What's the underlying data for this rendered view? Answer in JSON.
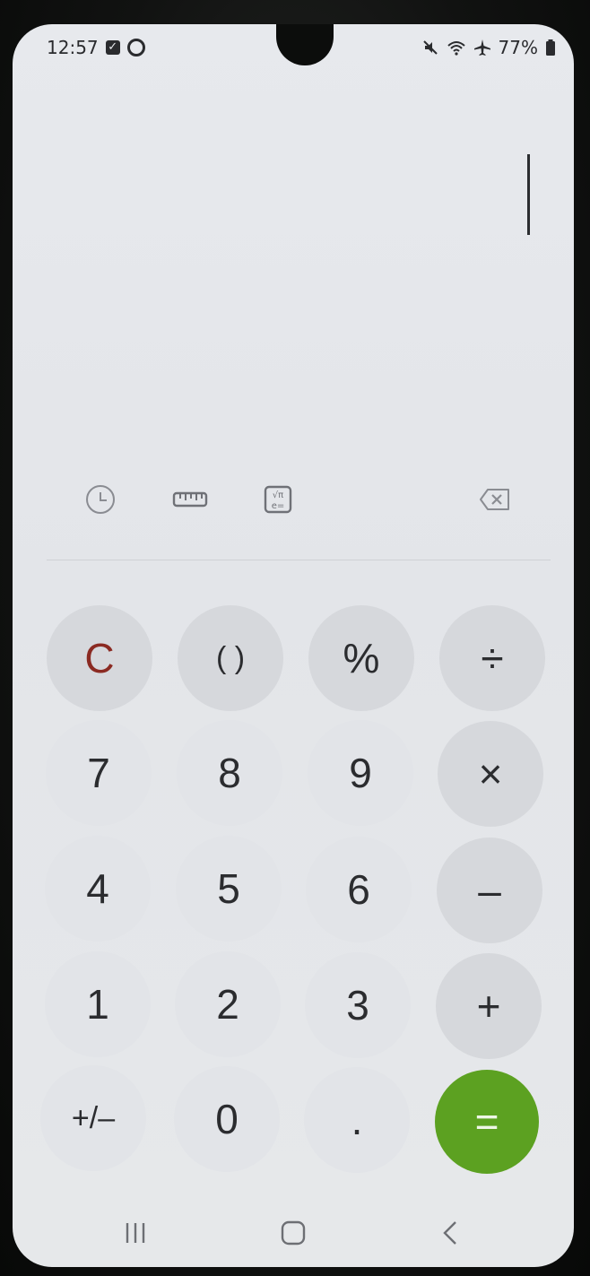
{
  "status_bar": {
    "time": "12:57",
    "battery_percent": "77%",
    "icons": [
      "check-icon",
      "circle-notification-icon",
      "mute-icon",
      "wifi-icon",
      "airplane-icon",
      "battery-icon"
    ]
  },
  "display": {
    "expression": "",
    "result": ""
  },
  "toolbar": {
    "history": "history-clock-icon",
    "unit_converter": "ruler-icon",
    "scientific": "scientific-functions-icon",
    "backspace": "backspace-icon"
  },
  "keys": {
    "clear": "C",
    "parentheses": "( )",
    "percent": "%",
    "divide": "÷",
    "seven": "7",
    "eight": "8",
    "nine": "9",
    "multiply": "×",
    "four": "4",
    "five": "5",
    "six": "6",
    "minus": "–",
    "one": "1",
    "two": "2",
    "three": "3",
    "plus": "+",
    "plus_minus": "+/–",
    "zero": "0",
    "decimal": ".",
    "equals": "="
  },
  "colors": {
    "equals_key": "#5ca121",
    "clear_text": "#8b2a22",
    "background": "#e6e8ea"
  },
  "nav_bar": [
    "recent-apps-icon",
    "home-icon",
    "back-icon"
  ]
}
